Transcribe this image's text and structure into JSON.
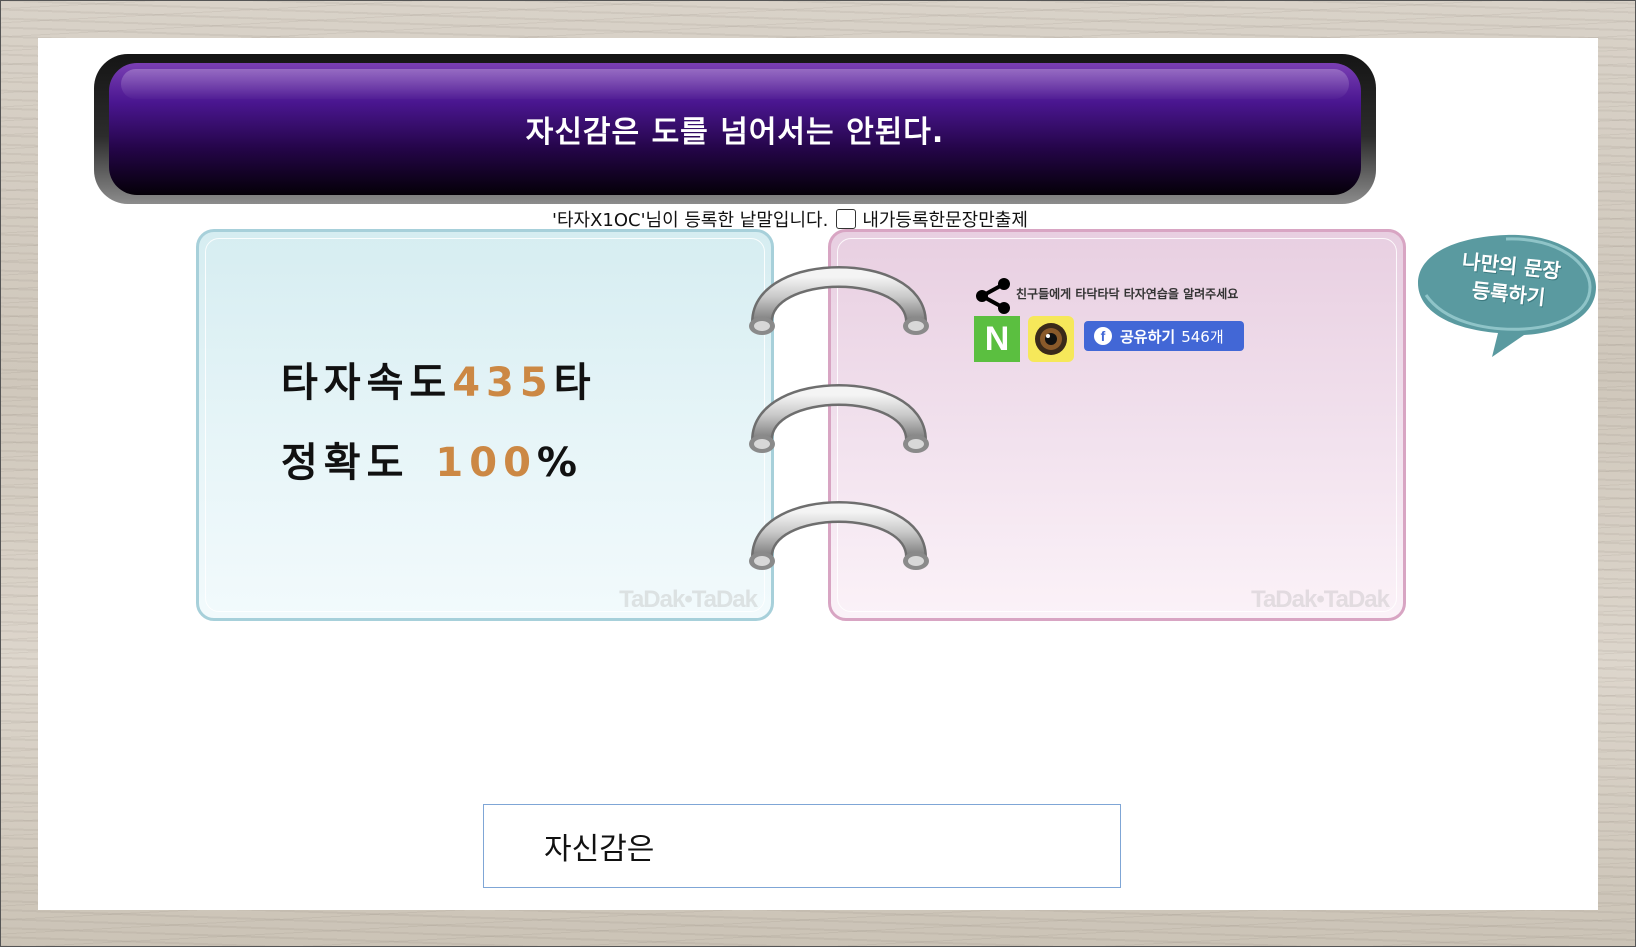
{
  "banner": {
    "sentence": "자신감은 도를 넘어서는 안된다."
  },
  "registrant": {
    "text": "'타자X1OC'님이 등록한 낱말입니다.",
    "checkbox_label": "내가등록한문장만출제",
    "checkbox_checked": false
  },
  "stats": {
    "speed_label": "타자속도",
    "speed_value": "435",
    "speed_unit": "타",
    "accuracy_label": "정확도",
    "accuracy_value": "100",
    "accuracy_unit": "%"
  },
  "watermark": "TaDak•TaDak",
  "share": {
    "text": "친구들에게 타닥타닥 타자연습을 알려주세요",
    "naver_label": "N",
    "facebook_label": "공유하기",
    "facebook_count": "546개"
  },
  "bubble": {
    "line1": "나만의 문장",
    "line2": "등록하기"
  },
  "typing_input": {
    "value": "자신감은"
  },
  "colors": {
    "accent_number": "#cc8844",
    "left_card_border": "#a7d0da",
    "right_card_border": "#d8a5c3",
    "facebook_blue": "#4267d6",
    "naver_green": "#5bbf40"
  },
  "icons": [
    "share-icon",
    "naver-icon",
    "camera-icon",
    "facebook-icon"
  ]
}
